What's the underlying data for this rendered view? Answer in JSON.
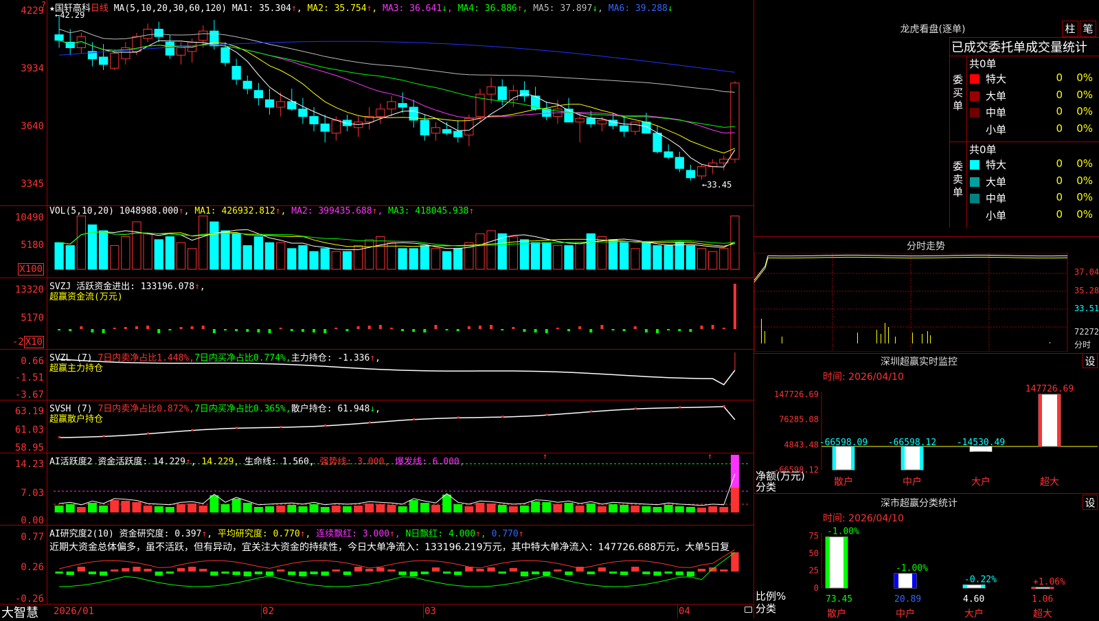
{
  "toolbar": {
    "star": "★",
    "stock_name": "国轩高科",
    "period": "日线"
  },
  "ma": {
    "label": "MA(5,10,20,30,60,120)",
    "ma1": "MA1: 35.304",
    "ma1_dir": "↑",
    "ma2": "MA2: 35.754",
    "ma2_dir": "↑",
    "ma3": "MA3: 36.641",
    "ma3_dir": "↓",
    "ma4": "MA4: 36.886",
    "ma4_dir": "↑",
    "ma5": "MA5: 37.897",
    "ma5_dir": "↓",
    "ma6": "MA6: 39.288",
    "ma6_dir": "↓"
  },
  "price_axis": [
    "4229",
    "3934",
    "3640",
    "3345"
  ],
  "price_marks": {
    "high": "42.29",
    "low": "33.45"
  },
  "vol": {
    "label": "VOL(5,10,20)",
    "value": "1048988.000",
    "value_dir": "↑",
    "ma1": "MA1: 426932.812",
    "ma1_dir": "↑",
    "ma2": "MA2: 399435.688",
    "ma2_dir": "↑",
    "ma3": "MA3: 418045.938",
    "ma3_dir": "↑",
    "axis": [
      "10490",
      "5180",
      "X100"
    ]
  },
  "svzj": {
    "label": "SVZJ",
    "title": "活跃资金进出: 133196.078",
    "dir": "↑",
    "sep": ",",
    "sub": "超赢资金流(万元)",
    "axis": [
      "13320",
      "5170",
      "-2",
      "X10"
    ]
  },
  "svzl": {
    "label": "SVZL (7)",
    "sell": "7日内卖净占比1.448%",
    "buy": "7日内买净占比0.774%",
    "hold": "主力持仓: -1.336",
    "dir": "↑",
    "sep": ",",
    "sub": "超赢主力持仓",
    "axis": [
      "0.66",
      "-1.51",
      "-3.67"
    ]
  },
  "svsh": {
    "label": "SVSH (7)",
    "sell": "7日内卖净占比0.872%",
    "buy": "7日内买净占比0.365%",
    "hold": "散户持仓: 61.948",
    "dir": "↓",
    "sep": ",",
    "sub": "超赢散户持仓",
    "axis": [
      "63.19",
      "61.03",
      "58.95"
    ]
  },
  "ai_active": {
    "label": "AI活跃度2",
    "activity": "资金活跃度: 14.229",
    "activity_dir": "↑",
    "val2": "14.229",
    "life": "生命线: 1.560",
    "strong": "强势线: 3.000",
    "burst": "爆发线: 6.000",
    "sep": ",",
    "axis": [
      "14.23",
      "7.03",
      "0.00"
    ]
  },
  "ai_research": {
    "label": "AI研究度2(10)",
    "research": "资金研究度: 0.397",
    "research_dir": "↑",
    "avg": "平均研究度: 0.770",
    "avg_dir": "↑",
    "red": "连续飘红: 3.000",
    "red_dir": "↑",
    "nred": "N日飘红: 4.000",
    "nred_dir": "↑",
    "val5": "0.770",
    "val5_dir": "↑",
    "sep": ",",
    "comment": "近期大资金总体偏多，虽不活跃，但有异动，宜关注大资金的持续性，今日大单净流入：133196.219万元，其中特大单净流入：147726.688万元，大单5日复",
    "axis": [
      "0.77",
      "0.26",
      "-0.26"
    ]
  },
  "date_axis": [
    "2026/01",
    "02",
    "03",
    "04"
  ],
  "brand": "大智慧",
  "dragon": {
    "title": "龙虎看盘(逐单)",
    "btn1": "柱",
    "btn2": "笔",
    "subtitle": "已成交委托单成交量统计",
    "buy_side": "委买单",
    "sell_side": "委卖单",
    "total": "共0单",
    "rows": [
      {
        "name": "特大",
        "count": "0",
        "pct": "0%",
        "color": "#ff0000"
      },
      {
        "name": "大单",
        "count": "0",
        "pct": "0%",
        "color": "#9a0000"
      },
      {
        "name": "中单",
        "count": "0",
        "pct": "0%",
        "color": "#700000"
      },
      {
        "name": "小单",
        "count": "0",
        "pct": "0%",
        "color": ""
      }
    ],
    "rows_sell": [
      {
        "name": "特大",
        "count": "0",
        "pct": "0%",
        "color": "#00ffff"
      },
      {
        "name": "大单",
        "count": "0",
        "pct": "0%",
        "color": "#00a0a0"
      },
      {
        "name": "中单",
        "count": "0",
        "pct": "0%",
        "color": "#008080"
      },
      {
        "name": "小单",
        "count": "0",
        "pct": "0%",
        "color": ""
      }
    ]
  },
  "intraday": {
    "title": "分时走势",
    "axis": [
      "37.04",
      "35.28",
      "33.51",
      "72272"
    ],
    "unit": "分时"
  },
  "sz_monitor": {
    "title": "深圳超赢实时监控",
    "settings": "设",
    "time": "时间: 2026/04/10",
    "axis": [
      "147726.69",
      "76285.08",
      "4843.48",
      "-66598.12"
    ],
    "bars": [
      {
        "cat": "散户",
        "value": -66598.09,
        "label": "-66598.09"
      },
      {
        "cat": "中户",
        "value": -66598.12,
        "label": "-66598.12"
      },
      {
        "cat": "大户",
        "value": -14530.49,
        "label": "-14530.49"
      },
      {
        "cat": "超大",
        "value": 147726.69,
        "label": "147726.69"
      }
    ],
    "ylabel": "净额(万元)",
    "xlabel": "分类"
  },
  "sz_class": {
    "title": "深市超赢分类统计",
    "settings": "设",
    "time": "时间: 2026/04/10",
    "axis": [
      "75",
      "50",
      "25",
      "0"
    ],
    "bars": [
      {
        "cat": "散户",
        "value": 73.45,
        "label": "73.45",
        "change": "-1.00%"
      },
      {
        "cat": "中户",
        "value": 20.89,
        "label": "20.89",
        "change": "-1.00%"
      },
      {
        "cat": "大户",
        "value": 4.6,
        "label": "4.60",
        "change": "-0.22%"
      },
      {
        "cat": "超大",
        "value": 1.06,
        "label": "1.06",
        "change": "+1.06%"
      }
    ],
    "ylabel": "比例%",
    "xlabel": "分类"
  },
  "chart_data": [
    {
      "type": "candlestick",
      "title": "国轩高科 日线",
      "ylim": [
        33.45,
        42.29
      ],
      "note_high": "42.29",
      "note_low": "33.45",
      "ohlc": [
        [
          41.3,
          42.3,
          40.6,
          41.0
        ],
        [
          40.9,
          41.6,
          40.2,
          40.6
        ],
        [
          40.6,
          41.4,
          40.3,
          41.2
        ],
        [
          40.4,
          40.9,
          39.6,
          40.0
        ],
        [
          40.1,
          40.8,
          39.4,
          39.7
        ],
        [
          39.5,
          40.5,
          39.4,
          40.3
        ],
        [
          40.0,
          40.9,
          39.7,
          40.6
        ],
        [
          40.4,
          41.4,
          40.2,
          41.2
        ],
        [
          41.1,
          41.9,
          40.9,
          41.6
        ],
        [
          41.6,
          42.0,
          40.9,
          41.2
        ],
        [
          40.9,
          41.3,
          40.0,
          40.2
        ],
        [
          40.2,
          40.9,
          39.7,
          40.6
        ],
        [
          40.4,
          41.1,
          39.8,
          40.9
        ],
        [
          41.0,
          41.8,
          40.6,
          41.5
        ],
        [
          41.5,
          42.1,
          40.5,
          40.7
        ],
        [
          40.6,
          40.9,
          39.6,
          39.8
        ],
        [
          39.6,
          40.0,
          38.6,
          38.9
        ],
        [
          38.8,
          39.1,
          38.1,
          38.4
        ],
        [
          38.3,
          38.7,
          37.5,
          37.9
        ],
        [
          37.8,
          38.4,
          37.0,
          37.4
        ],
        [
          37.4,
          38.2,
          36.9,
          37.7
        ],
        [
          37.7,
          38.4,
          37.2,
          37.3
        ],
        [
          37.3,
          37.9,
          36.5,
          36.9
        ],
        [
          36.9,
          37.4,
          36.1,
          36.5
        ],
        [
          36.5,
          37.0,
          35.5,
          36.1
        ],
        [
          36.0,
          36.9,
          35.6,
          36.7
        ],
        [
          36.7,
          37.0,
          36.1,
          36.4
        ],
        [
          36.3,
          36.9,
          35.8,
          36.6
        ],
        [
          36.6,
          37.4,
          36.2,
          36.9
        ],
        [
          36.9,
          37.6,
          36.5,
          37.3
        ],
        [
          37.3,
          38.0,
          36.9,
          37.7
        ],
        [
          37.6,
          38.2,
          37.1,
          37.4
        ],
        [
          37.4,
          37.8,
          36.3,
          36.7
        ],
        [
          36.7,
          37.0,
          35.6,
          35.9
        ],
        [
          36.0,
          36.6,
          35.6,
          36.3
        ],
        [
          36.2,
          36.6,
          35.9,
          36.0
        ],
        [
          36.1,
          36.7,
          35.5,
          35.8
        ],
        [
          35.9,
          37.0,
          35.3,
          36.8
        ],
        [
          36.9,
          38.4,
          36.6,
          38.1
        ],
        [
          38.1,
          39.0,
          37.6,
          38.5
        ],
        [
          38.5,
          38.9,
          37.5,
          37.8
        ],
        [
          37.8,
          38.6,
          37.4,
          38.3
        ],
        [
          38.3,
          38.8,
          37.7,
          38.0
        ],
        [
          38.0,
          38.5,
          37.2,
          37.3
        ],
        [
          37.3,
          37.7,
          36.7,
          36.9
        ],
        [
          36.9,
          37.8,
          36.5,
          37.3
        ],
        [
          37.3,
          37.9,
          36.7,
          36.6
        ],
        [
          36.6,
          37.1,
          35.5,
          36.8
        ],
        [
          36.8,
          37.2,
          36.3,
          36.5
        ],
        [
          36.5,
          36.9,
          36.1,
          36.7
        ],
        [
          36.7,
          37.1,
          36.2,
          36.4
        ],
        [
          36.4,
          36.9,
          35.8,
          36.1
        ],
        [
          36.1,
          36.6,
          35.9,
          36.6
        ],
        [
          36.6,
          37.1,
          36.2,
          36.0
        ],
        [
          36.0,
          36.4,
          34.9,
          35.0
        ],
        [
          35.0,
          35.4,
          34.6,
          34.7
        ],
        [
          34.7,
          35.0,
          33.9,
          34.1
        ],
        [
          34.0,
          34.3,
          33.45,
          33.6
        ],
        [
          33.7,
          34.3,
          33.5,
          34.2
        ],
        [
          34.2,
          34.6,
          33.8,
          34.4
        ],
        [
          34.4,
          34.8,
          34.0,
          34.6
        ],
        [
          34.6,
          38.8,
          34.4,
          38.7
        ]
      ]
    },
    {
      "type": "bar",
      "title": "VOL(5,10,20)",
      "values": [
        9,
        8,
        18,
        15,
        13,
        8,
        11,
        16,
        12,
        10,
        11,
        9,
        7,
        18,
        16,
        13,
        12,
        8,
        11,
        9,
        9,
        7,
        8,
        6,
        7,
        6,
        6,
        8,
        10,
        11,
        9,
        7,
        7,
        8,
        7,
        6,
        7,
        9,
        12,
        13,
        12,
        11,
        10,
        9,
        9,
        8,
        8,
        9,
        12,
        11,
        10,
        9,
        7,
        9,
        8,
        8,
        9,
        8,
        7,
        6,
        7,
        18
      ]
    }
  ]
}
